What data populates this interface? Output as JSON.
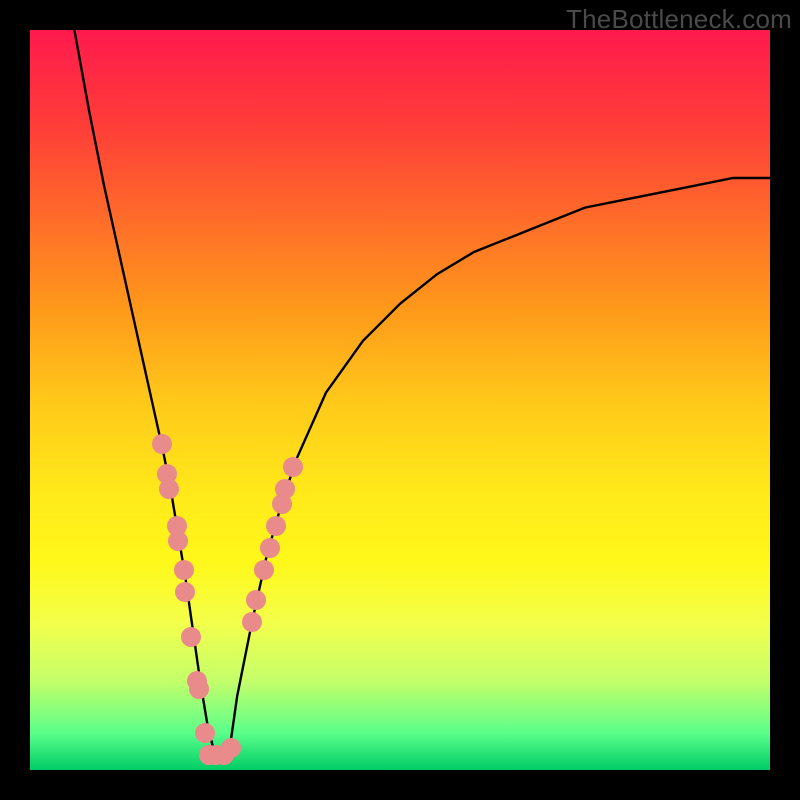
{
  "watermark": "TheBottleneck.com",
  "colors": {
    "dot": "#e98b8b",
    "curve": "#000000",
    "frame": "#000000"
  },
  "chart_data": {
    "type": "line",
    "title": "",
    "xlabel": "",
    "ylabel": "",
    "xlim": [
      0,
      100
    ],
    "ylim": [
      0,
      100
    ],
    "curve": {
      "x": [
        6,
        8,
        10,
        12,
        14,
        16,
        18,
        19,
        20,
        21,
        22,
        23,
        24,
        25,
        26,
        27,
        28,
        30,
        32,
        34,
        36,
        40,
        45,
        50,
        55,
        60,
        65,
        70,
        75,
        80,
        85,
        90,
        95,
        100
      ],
      "y": [
        100,
        89,
        79,
        70,
        61,
        52,
        43,
        38,
        32,
        26,
        19,
        12,
        6,
        2,
        2,
        3,
        10,
        20,
        29,
        36,
        42,
        51,
        58,
        63,
        67,
        70,
        72,
        74,
        76,
        77,
        78,
        79,
        80,
        80
      ]
    },
    "markers_left": {
      "x": [
        17.8,
        18.5,
        18.8,
        19.8,
        20.0,
        20.8,
        21.0,
        21.8,
        22.5,
        22.8,
        23.6,
        24.2
      ],
      "y": [
        44,
        40,
        38,
        33,
        31,
        27,
        24,
        18,
        12,
        11,
        5,
        2
      ]
    },
    "markers_right": {
      "x": [
        30.0,
        30.6,
        31.6,
        32.4,
        33.2,
        34.0,
        34.4,
        35.6
      ],
      "y": [
        20,
        23,
        27,
        30,
        33,
        36,
        38,
        41
      ]
    },
    "markers_min": {
      "x": [
        24.2,
        25.2,
        26.2,
        27.2
      ],
      "y": [
        2,
        2,
        2,
        3
      ]
    }
  }
}
